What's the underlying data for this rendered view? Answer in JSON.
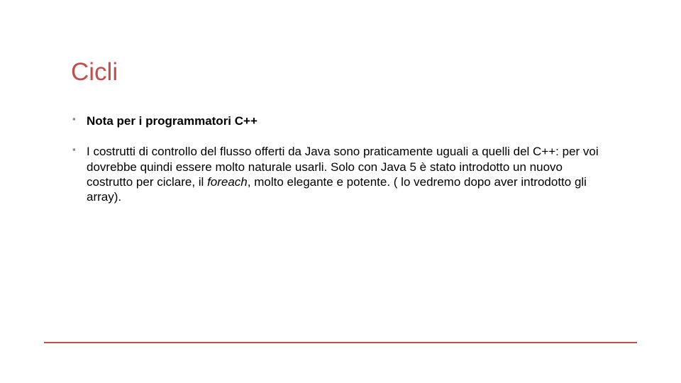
{
  "slide": {
    "title": "Cicli",
    "bullets": [
      {
        "text": "Nota per i programmatori C++",
        "bold": true
      },
      {
        "text_pre": "I costrutti di controllo del flusso offerti da Java sono praticamente uguali a quelli del C++: per voi dovrebbe quindi essere molto naturale usarli. Solo con Java 5 è stato introdotto un nuovo costrutto per ciclare, il ",
        "italic": "foreach",
        "text_post": ", molto elegante e potente. ( lo vedremo dopo aver introdotto gli array)."
      }
    ]
  },
  "colors": {
    "accent": "#c0504d"
  }
}
